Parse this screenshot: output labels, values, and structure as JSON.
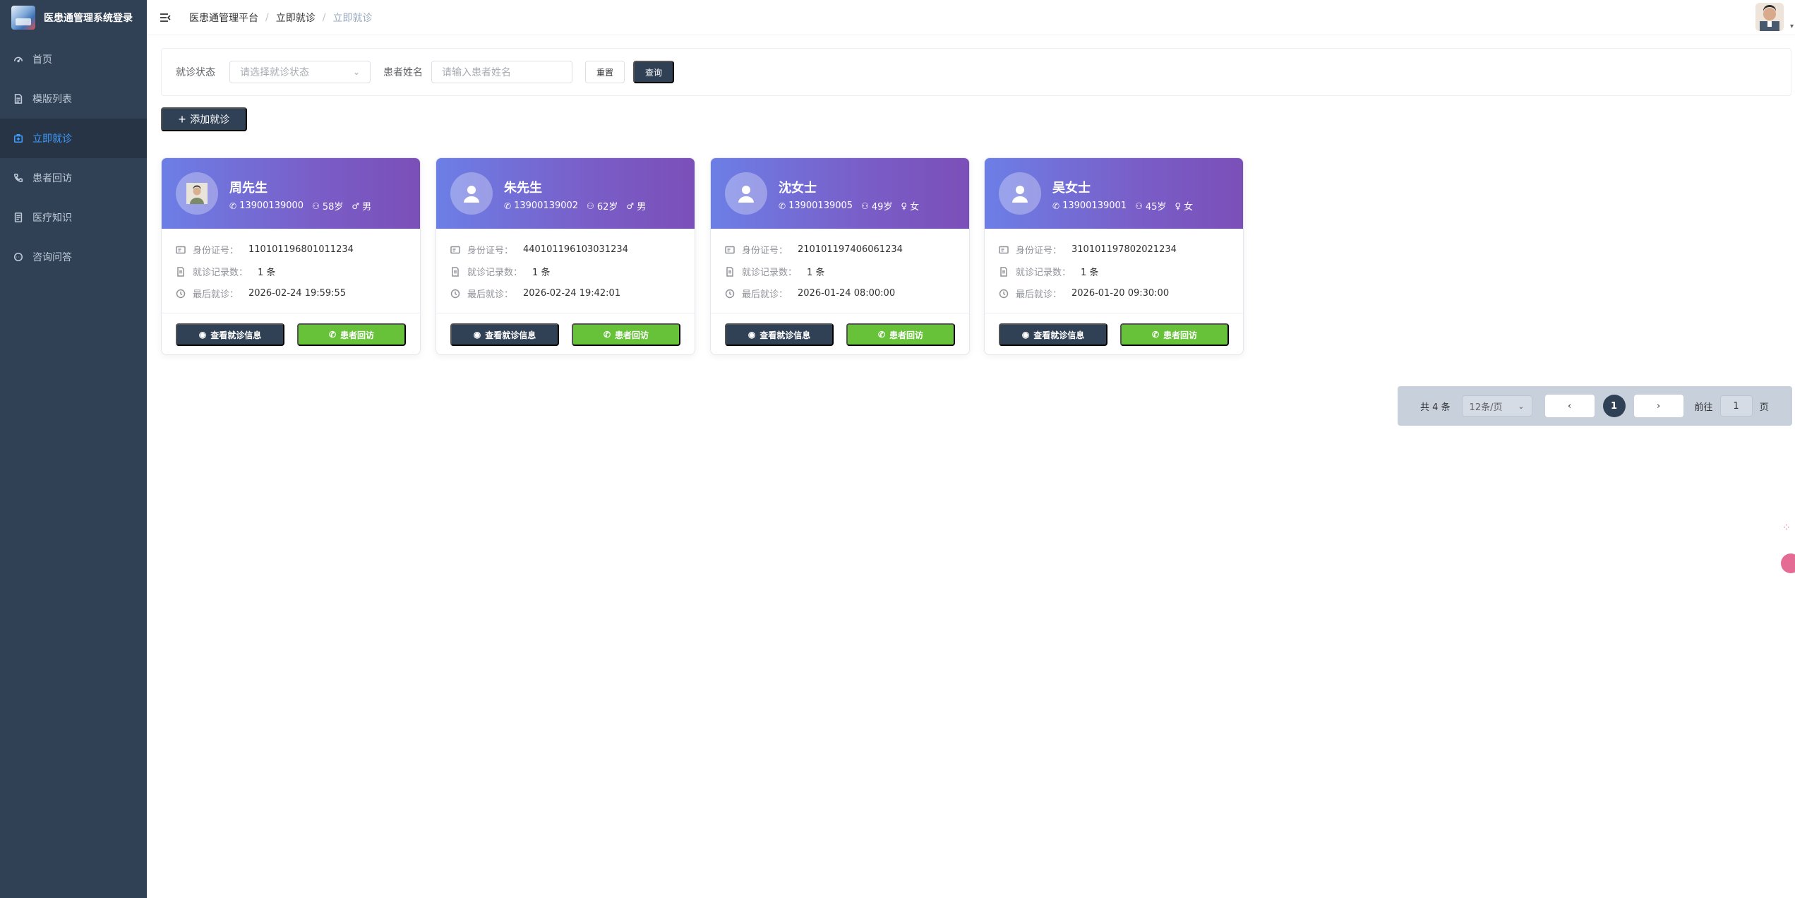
{
  "app": {
    "title": "医患通管理系统登录"
  },
  "sidebar": {
    "items": [
      {
        "label": "首页",
        "icon": "dashboard-icon"
      },
      {
        "label": "模版列表",
        "icon": "document-icon"
      },
      {
        "label": "立即就诊",
        "icon": "medical-kit-icon",
        "active": true
      },
      {
        "label": "患者回访",
        "icon": "phone-icon"
      },
      {
        "label": "医疗知识",
        "icon": "book-icon"
      },
      {
        "label": "咨询问答",
        "icon": "chat-icon"
      }
    ]
  },
  "breadcrumb": [
    "医患通管理平台",
    "立即就诊",
    "立即就诊"
  ],
  "filter": {
    "status_label": "就诊状态",
    "status_placeholder": "请选择就诊状态",
    "name_label": "患者姓名",
    "name_placeholder": "请输入患者姓名",
    "reset": "重置",
    "search": "查询"
  },
  "add_button": "添加就诊",
  "card_labels": {
    "id": "身份证号：",
    "records": "就诊记录数：",
    "last": "最后就诊：",
    "view": "查看就诊信息",
    "visit": "患者回访"
  },
  "patients": [
    {
      "name": "周先生",
      "phone": "13900139000",
      "age": "58岁",
      "gender": "男",
      "gender_icon": "male-icon",
      "id": "110101196801011234",
      "records": "1 条",
      "last": "2026-02-24 19:59:55",
      "photo": true
    },
    {
      "name": "朱先生",
      "phone": "13900139002",
      "age": "62岁",
      "gender": "男",
      "gender_icon": "male-icon",
      "id": "440101196103031234",
      "records": "1 条",
      "last": "2026-02-24 19:42:01",
      "photo": false
    },
    {
      "name": "沈女士",
      "phone": "13900139005",
      "age": "49岁",
      "gender": "女",
      "gender_icon": "female-icon",
      "id": "210101197406061234",
      "records": "1 条",
      "last": "2026-01-24 08:00:00",
      "photo": false
    },
    {
      "name": "吴女士",
      "phone": "13900139001",
      "age": "45岁",
      "gender": "女",
      "gender_icon": "female-icon",
      "id": "310101197802021234",
      "records": "1 条",
      "last": "2026-01-20 09:30:00",
      "photo": false
    }
  ],
  "pagination": {
    "total": "共 4 条",
    "page_size": "12条/页",
    "current": "1",
    "goto_label": "前往",
    "goto_value": "1",
    "page_unit": "页"
  },
  "colors": {
    "sidebar_bg": "#304156",
    "active_text": "#409eff",
    "primary_dark": "#304156",
    "success": "#67c23a",
    "card_header_start": "#6c7fe6",
    "card_header_end": "#7b4fb8"
  }
}
